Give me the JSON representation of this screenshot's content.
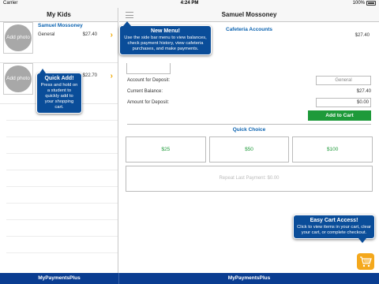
{
  "status_bar": {
    "carrier": "Carrier",
    "time": "4:24 PM",
    "battery": "100%"
  },
  "left_panel": {
    "title": "My Kids",
    "kids": [
      {
        "photo_label": "Add photo",
        "name": "Samuel Mossoney",
        "plan": "General",
        "amount": "$27.40"
      },
      {
        "photo_label": "Add photo",
        "name": "",
        "plan": "",
        "amount": "$22.70"
      }
    ]
  },
  "right_panel": {
    "title": "Samuel Mossoney",
    "cafeteria": {
      "title": "Cafeteria Accounts",
      "amount": "$27.40"
    },
    "form": {
      "account_label": "Account for Deposit:",
      "account_value": "General",
      "balance_label": "Current Balance:",
      "balance_value": "$27.40",
      "deposit_label": "Amount for Deposit:",
      "deposit_value": "$0.00",
      "add_to_cart": "Add to Cart"
    },
    "quick_choice": {
      "title": "Quick Choice",
      "options": [
        "$25",
        "$50",
        "$100"
      ],
      "repeat": "Repeat Last Payment: $0.00"
    }
  },
  "tips": {
    "menu": {
      "title": "New Menu!",
      "body": "Use the side bar menu to view balances, check payment history, view cafeteria purchases, and make payments."
    },
    "quick_add": {
      "title": "Quick Add!",
      "body": "Press and hold on a student to quickly add to your shopping cart."
    },
    "cart": {
      "title": "Easy Cart Access!",
      "body": "Click to view items in your cart, clear your cart, or complete checkout."
    }
  },
  "tab_bar": {
    "left": "MyPaymentsPlus",
    "right": "MyPaymentsPlus"
  },
  "colors": {
    "brand_blue": "#0a3d91",
    "link_blue": "#0a62b0",
    "green": "#1e9a3a",
    "orange": "#f4a81c"
  },
  "icons": [
    "menu-icon",
    "chevron-right-icon",
    "shopping-cart-icon",
    "battery-icon"
  ]
}
